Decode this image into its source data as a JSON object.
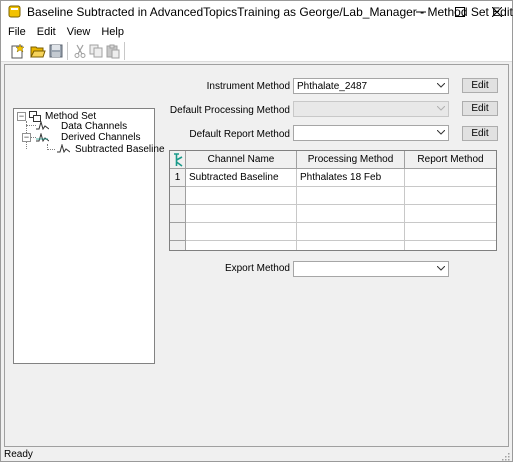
{
  "window": {
    "title": "Baseline Subtracted in AdvancedTopicsTraining as George/Lab_Manager - Method Set Editor"
  },
  "menu": {
    "items": [
      "File",
      "Edit",
      "View",
      "Help"
    ]
  },
  "toolbar": {
    "buttons": [
      "new-icon",
      "open-icon",
      "save-icon",
      "cut-icon",
      "copy-icon",
      "paste-icon"
    ]
  },
  "tree": {
    "root": "Method Set",
    "data_channels": "Data Channels",
    "derived_channels": "Derived Channels",
    "subtracted_baseline": "Subtracted Baseline"
  },
  "form": {
    "instrument_method_label": "Instrument Method",
    "instrument_method_value": "Phthalate_2487",
    "default_processing_label": "Default Processing Method",
    "default_processing_value": "",
    "default_report_label": "Default Report Method",
    "default_report_value": "",
    "export_method_label": "Export Method",
    "export_method_value": "",
    "edit_label": "Edit"
  },
  "grid": {
    "columns": [
      "Channel Name",
      "Processing Method",
      "Report Method"
    ],
    "rows": [
      {
        "num": "1",
        "channel": "Subtracted Baseline",
        "processing": "Phthalates 18 Feb",
        "report": ""
      }
    ]
  },
  "status": {
    "text": "Ready"
  },
  "colors": {
    "accent_icon": "#e8b400",
    "grid_icon": "#1a9a8a"
  }
}
